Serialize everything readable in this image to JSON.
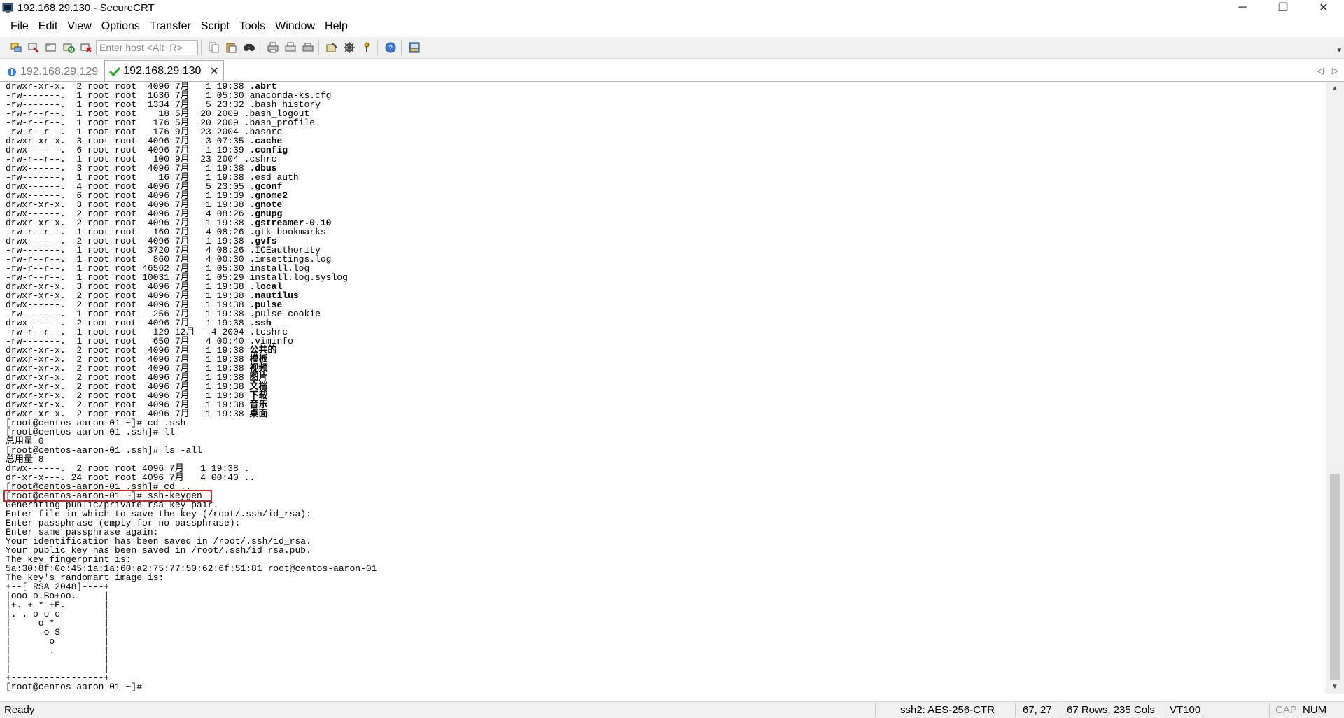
{
  "window": {
    "title": "192.168.29.130 - SecureCRT",
    "minimize_glyph": "─",
    "restore_glyph": "❐",
    "close_glyph": "✕"
  },
  "menu": [
    "File",
    "Edit",
    "View",
    "Options",
    "Transfer",
    "Script",
    "Tools",
    "Window",
    "Help"
  ],
  "toolbar": {
    "host_placeholder": "Enter host <Alt+R>",
    "overflow_glyph": "▾"
  },
  "tabs": [
    {
      "label": "192.168.29.129",
      "active": false,
      "icon": "session-disconnected-icon"
    },
    {
      "label": "192.168.29.130",
      "active": true,
      "icon": "check-icon"
    }
  ],
  "tab_close_glyph": "✕",
  "tab_nav": {
    "prev": "◁",
    "next": "▷"
  },
  "terminal": {
    "lines": [
      {
        "t": "drwxr-xr-x.  2 root root  4096 7月   1 19:38 ",
        "b": ".abrt"
      },
      {
        "t": "-rw-------.  1 root root  1636 7月   1 05:30 anaconda-ks.cfg"
      },
      {
        "t": "-rw-------.  1 root root  1334 7月   5 23:32 .bash_history"
      },
      {
        "t": "-rw-r--r--.  1 root root    18 5月  20 2009 .bash_logout"
      },
      {
        "t": "-rw-r--r--.  1 root root   176 5月  20 2009 .bash_profile"
      },
      {
        "t": "-rw-r--r--.  1 root root   176 9月  23 2004 .bashrc"
      },
      {
        "t": "drwxr-xr-x.  3 root root  4096 7月   3 07:35 ",
        "b": ".cache"
      },
      {
        "t": "drwx------.  6 root root  4096 7月   1 19:39 ",
        "b": ".config"
      },
      {
        "t": "-rw-r--r--.  1 root root   100 9月  23 2004 .cshrc"
      },
      {
        "t": "drwx------.  3 root root  4096 7月   1 19:38 ",
        "b": ".dbus"
      },
      {
        "t": "-rw-------.  1 root root    16 7月   1 19:38 .esd_auth"
      },
      {
        "t": "drwx------.  4 root root  4096 7月   5 23:05 ",
        "b": ".gconf"
      },
      {
        "t": "drwx------.  6 root root  4096 7月   1 19:39 ",
        "b": ".gnome2"
      },
      {
        "t": "drwxr-xr-x.  3 root root  4096 7月   1 19:38 ",
        "b": ".gnote"
      },
      {
        "t": "drwx------.  2 root root  4096 7月   4 08:26 ",
        "b": ".gnupg"
      },
      {
        "t": "drwxr-xr-x.  2 root root  4096 7月   1 19:38 ",
        "b": ".gstreamer-0.10"
      },
      {
        "t": "-rw-r--r--.  1 root root   160 7月   4 08:26 .gtk-bookmarks"
      },
      {
        "t": "drwx------.  2 root root  4096 7月   1 19:38 ",
        "b": ".gvfs"
      },
      {
        "t": "-rw-------.  1 root root  3720 7月   4 08:26 .ICEauthority"
      },
      {
        "t": "-rw-r--r--.  1 root root   860 7月   4 00:30 .imsettings.log"
      },
      {
        "t": "-rw-r--r--.  1 root root 46562 7月   1 05:30 install.log"
      },
      {
        "t": "-rw-r--r--.  1 root root 10031 7月   1 05:29 install.log.syslog"
      },
      {
        "t": "drwxr-xr-x.  3 root root  4096 7月   1 19:38 ",
        "b": ".local"
      },
      {
        "t": "drwxr-xr-x.  2 root root  4096 7月   1 19:38 ",
        "b": ".nautilus"
      },
      {
        "t": "drwx------.  2 root root  4096 7月   1 19:38 ",
        "b": ".pulse"
      },
      {
        "t": "-rw-------.  1 root root   256 7月   1 19:38 .pulse-cookie"
      },
      {
        "t": "drwx------.  2 root root  4096 7月   1 19:38 ",
        "b": ".ssh"
      },
      {
        "t": "-rw-r--r--.  1 root root   129 12月   4 2004 .tcshrc"
      },
      {
        "t": "-rw-------.  1 root root   650 7月   4 00:40 .viminfo"
      },
      {
        "t": "drwxr-xr-x.  2 root root  4096 7月   1 19:38 ",
        "b": "公共的"
      },
      {
        "t": "drwxr-xr-x.  2 root root  4096 7月   1 19:38 ",
        "b": "模板"
      },
      {
        "t": "drwxr-xr-x.  2 root root  4096 7月   1 19:38 ",
        "b": "视频"
      },
      {
        "t": "drwxr-xr-x.  2 root root  4096 7月   1 19:38 ",
        "b": "图片"
      },
      {
        "t": "drwxr-xr-x.  2 root root  4096 7月   1 19:38 ",
        "b": "文档"
      },
      {
        "t": "drwxr-xr-x.  2 root root  4096 7月   1 19:38 ",
        "b": "下载"
      },
      {
        "t": "drwxr-xr-x.  2 root root  4096 7月   1 19:38 ",
        "b": "音乐"
      },
      {
        "t": "drwxr-xr-x.  2 root root  4096 7月   1 19:38 ",
        "b": "桌面"
      },
      {
        "t": "[root@centos-aaron-01 ~]# cd .ssh"
      },
      {
        "t": "[root@centos-aaron-01 .ssh]# ll"
      },
      {
        "t": "总用量 0"
      },
      {
        "t": "[root@centos-aaron-01 .ssh]# ls -all"
      },
      {
        "t": "总用量 8"
      },
      {
        "t": "drwx------.  2 root root 4096 7月   1 19:38 ",
        "b": "."
      },
      {
        "t": "dr-xr-x---. 24 root root 4096 7月   4 00:40 ",
        "b": ".."
      },
      {
        "t": "[root@centos-aaron-01 .ssh]# cd .."
      },
      {
        "t": "[root@centos-aaron-01 ~]# ssh-keygen"
      },
      {
        "t": "Generating public/private rsa key pair."
      },
      {
        "t": "Enter file in which to save the key (/root/.ssh/id_rsa):"
      },
      {
        "t": "Enter passphrase (empty for no passphrase):"
      },
      {
        "t": "Enter same passphrase again:"
      },
      {
        "t": "Your identification has been saved in /root/.ssh/id_rsa."
      },
      {
        "t": "Your public key has been saved in /root/.ssh/id_rsa.pub."
      },
      {
        "t": "The key fingerprint is:"
      },
      {
        "t": "5a:30:8f:0c:45:1a:1a:60:a2:75:77:50:62:6f:51:81 root@centos-aaron-01"
      },
      {
        "t": "The key's randomart image is:"
      },
      {
        "t": "+--[ RSA 2048]----+"
      },
      {
        "t": "|ooo o.Bo+oo.     |"
      },
      {
        "t": "|+. + * +E.       |"
      },
      {
        "t": "|. . o o o        |"
      },
      {
        "t": "|     o *         |"
      },
      {
        "t": "|      o S        |"
      },
      {
        "t": "|       o         |"
      },
      {
        "t": "|       .         |"
      },
      {
        "t": "|                 |"
      },
      {
        "t": "|                 |"
      },
      {
        "t": "+-----------------+"
      },
      {
        "t": "[root@centos-aaron-01 ~]#"
      }
    ]
  },
  "status": {
    "ready": "Ready",
    "cipher": "ssh2: AES-256-CTR",
    "cursor": "67,  27",
    "size": "67 Rows, 235 Cols",
    "term": "VT100",
    "cap": "CAP",
    "num": "NUM"
  },
  "colors": {
    "highlight": "#e02020",
    "toolbar_bg": "#f0f0f0"
  }
}
